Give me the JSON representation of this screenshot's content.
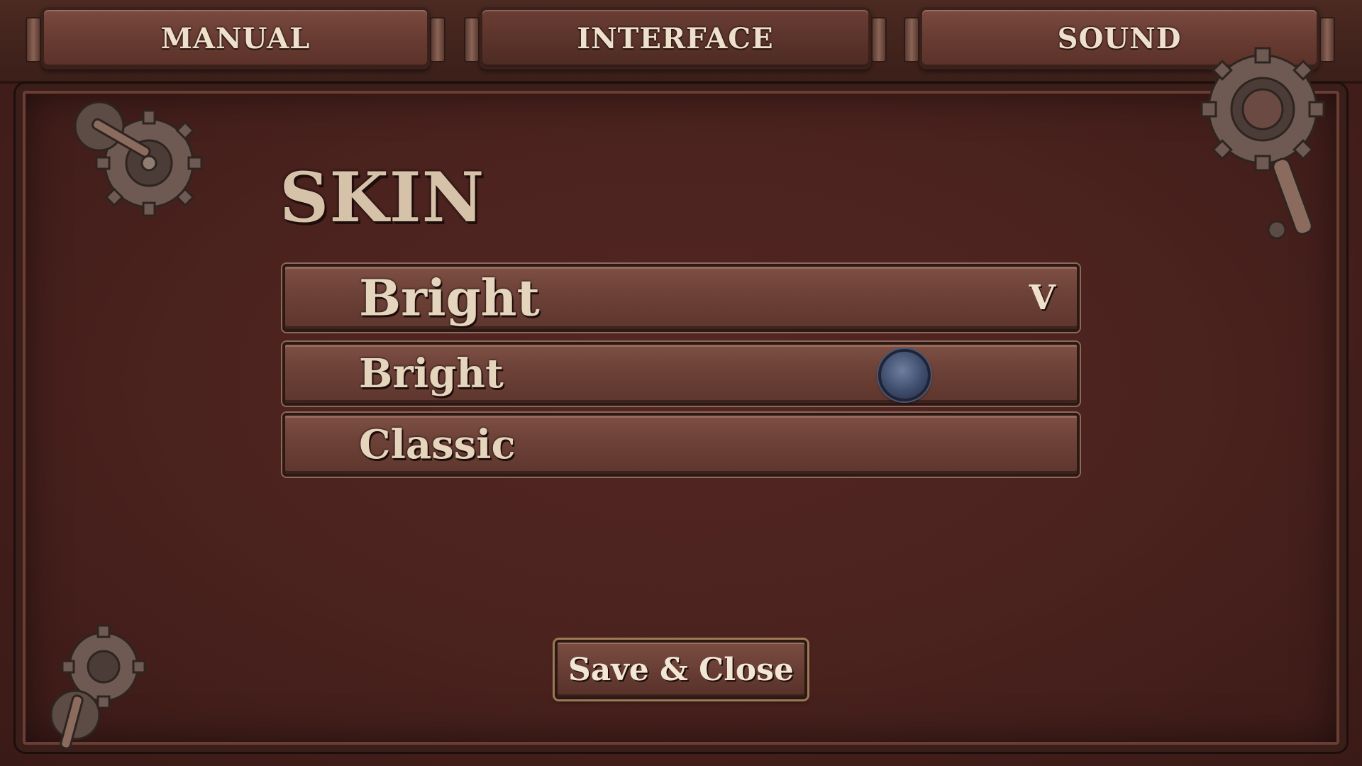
{
  "tabs": [
    {
      "label": "MANUAL"
    },
    {
      "label": "INTERFACE"
    },
    {
      "label": "SOUND"
    }
  ],
  "section": {
    "title": "SKIN"
  },
  "skin_dropdown": {
    "selected": "Bright",
    "chevron": "V",
    "options": [
      {
        "label": "Bright"
      },
      {
        "label": "Classic"
      }
    ]
  },
  "footer": {
    "save_label": "Save & Close"
  },
  "icons": {
    "decor": "gear-icon",
    "cursor": "cursor-icon"
  }
}
